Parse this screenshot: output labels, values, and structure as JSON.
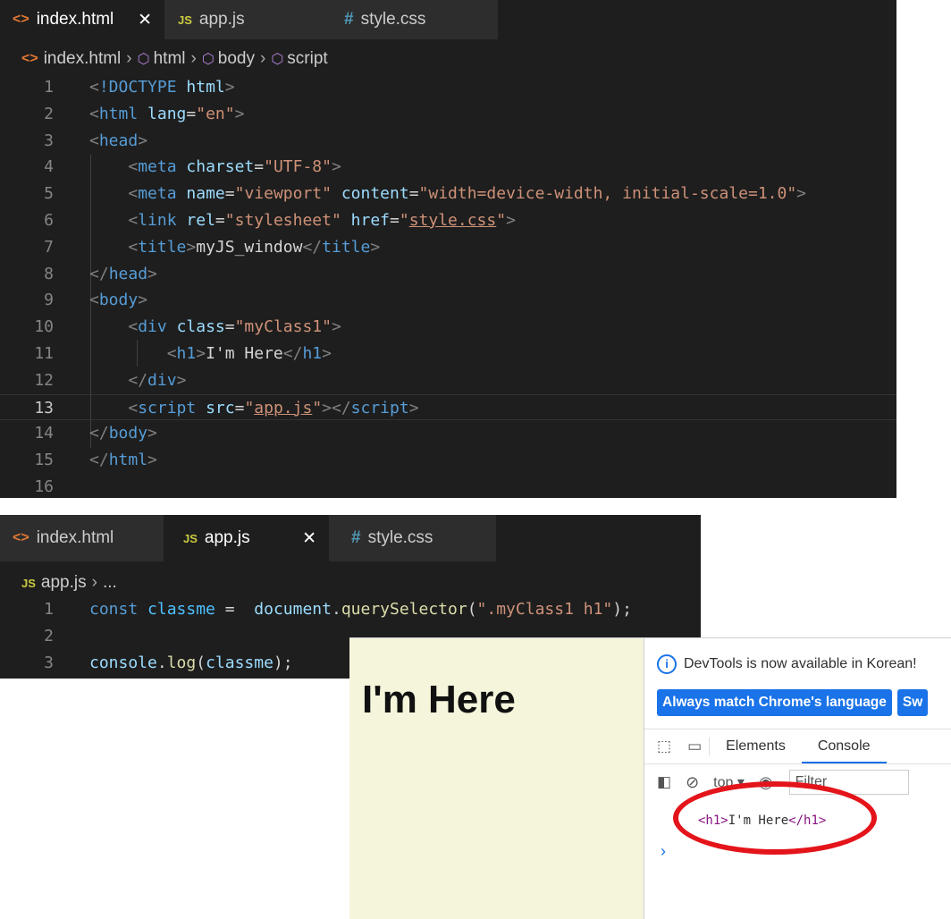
{
  "editor1": {
    "tabs": [
      {
        "icon": "<>",
        "label": "index.html",
        "close": "✕"
      },
      {
        "icon": "JS",
        "label": "app.js"
      },
      {
        "icon": "#",
        "label": "style.css"
      }
    ],
    "breadcrumb": [
      "index.html",
      "html",
      "body",
      "script"
    ],
    "line_numbers": [
      "1",
      "2",
      "3",
      "4",
      "5",
      "6",
      "7",
      "8",
      "9",
      "10",
      "11",
      "12",
      "13",
      "14",
      "15",
      "16"
    ],
    "current_line": "13"
  },
  "editor2": {
    "tabs": [
      {
        "icon": "<>",
        "label": "index.html"
      },
      {
        "icon": "JS",
        "label": "app.js",
        "close": "✕"
      },
      {
        "icon": "#",
        "label": "style.css"
      }
    ],
    "breadcrumb": [
      "app.js",
      "..."
    ],
    "line_numbers": [
      "1",
      "2",
      "3"
    ]
  },
  "browser": {
    "heading": "I'm Here",
    "devtools": {
      "info_text": "DevTools is now available in Korean!",
      "button_primary": "Always match Chrome's language",
      "button_secondary": "Sw",
      "tabs": [
        "Elements",
        "Console"
      ],
      "context": "top",
      "filter_placeholder": "Filter",
      "log_open": "<h1>",
      "log_text": "I'm Here",
      "log_close": "</h1>",
      "prompt": "›"
    }
  },
  "colors": {
    "editor_bg": "#1e1e1e",
    "tag": "#569cd6",
    "attr": "#9cdcfe",
    "string": "#ce9178",
    "page_bg": "#f5f5dc",
    "highlight_ring": "#e4141b",
    "devtools_accent": "#1a73e8"
  }
}
